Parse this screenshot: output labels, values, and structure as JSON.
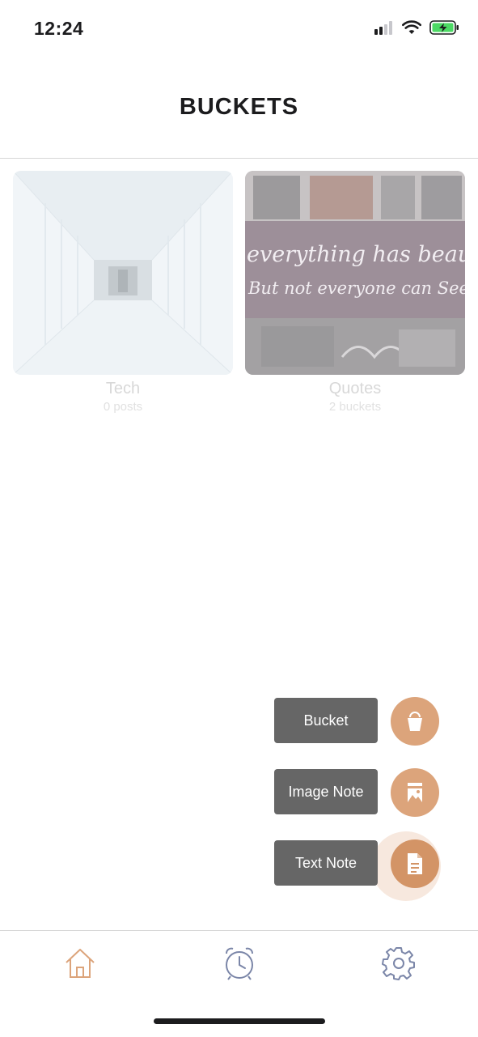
{
  "status_bar": {
    "time": "12:24"
  },
  "header": {
    "title": "BUCKETS"
  },
  "buckets": [
    {
      "title": "Tech",
      "subtitle": "0 posts",
      "image": "hallway-photo"
    },
    {
      "title": "Quotes",
      "subtitle": "2 buckets",
      "image": "graffiti-wall-photo",
      "image_text_line1": "everything has beauty",
      "image_text_line2": "But not everyone can See it"
    }
  ],
  "fab_menu": {
    "items": [
      {
        "label": "Bucket",
        "icon": "bucket-icon"
      },
      {
        "label": "Image Note",
        "icon": "image-note-icon"
      },
      {
        "label": "Text Note",
        "icon": "text-note-icon"
      }
    ]
  },
  "tab_bar": {
    "tabs": [
      {
        "name": "home",
        "icon": "home-icon",
        "active": true
      },
      {
        "name": "reminders",
        "icon": "alarm-clock-icon",
        "active": false
      },
      {
        "name": "settings",
        "icon": "gear-icon",
        "active": false
      }
    ]
  },
  "colors": {
    "accent": "#dca47b",
    "label_bg": "#666666",
    "inactive_icon": "#7b86a8"
  }
}
